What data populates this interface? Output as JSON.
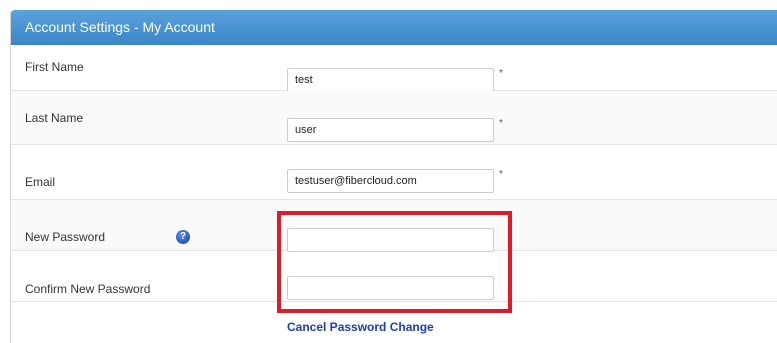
{
  "header": {
    "title": "Account Settings - My Account"
  },
  "fields": {
    "first_name": {
      "label": "First Name",
      "value": "test",
      "required_mark": "*"
    },
    "last_name": {
      "label": "Last Name",
      "value": "user",
      "required_mark": "*"
    },
    "email": {
      "label": "Email",
      "value": "testuser@fibercloud.com",
      "required_mark": "*"
    },
    "new_password": {
      "label": "New Password",
      "value": "",
      "help_icon": "question-icon",
      "help_glyph": "?"
    },
    "confirm_password": {
      "label": "Confirm New Password",
      "value": ""
    }
  },
  "actions": {
    "cancel_password_change": "Cancel Password Change"
  },
  "annotation": {
    "highlight_color": "#e2182b"
  },
  "colors": {
    "header_bg": "#4a94d2",
    "link": "#1a3ad0"
  }
}
